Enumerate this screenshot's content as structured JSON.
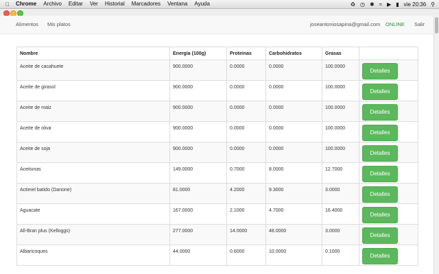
{
  "menubar": {
    "items": [
      "Chrome",
      "Archivo",
      "Editar",
      "Ver",
      "Historial",
      "Marcadores",
      "Ventana",
      "Ayuda"
    ],
    "clock": "vie 20:36"
  },
  "nav": {
    "left": [
      "Alimentos",
      "Mis platos"
    ],
    "email": "joseantoniosapina@gmail.com",
    "status": "ONLINE",
    "logout": "Salir"
  },
  "table": {
    "headers": [
      "Nombre",
      "Energia (100g)",
      "Proteinas",
      "Carbohidratos",
      "Grasas",
      ""
    ],
    "button_label": "Detalles",
    "rows": [
      [
        "Aceite de cacahuete",
        "900.0000",
        "0.0000",
        "0.0000",
        "100.0000"
      ],
      [
        "Aceite de girasol",
        "900.0000",
        "0.0000",
        "0.0000",
        "100.0000"
      ],
      [
        "Aceite de maiz",
        "900.0000",
        "0.0000",
        "0.0000",
        "100.0000"
      ],
      [
        "Aceite de oliva",
        "900.0000",
        "0.0000",
        "0.0000",
        "100.0000"
      ],
      [
        "Aceite de soja",
        "900.0000",
        "0.0000",
        "0.0000",
        "100.0000"
      ],
      [
        "Aceitunas",
        "149.0000",
        "0.7000",
        "8.0000",
        "12.7000"
      ],
      [
        "Actimel batido (Danone)",
        "81.0000",
        "4.2000",
        "9.3000",
        "3.0000"
      ],
      [
        "Aguacate",
        "167.0000",
        "2.1000",
        "4.7000",
        "16.4000"
      ],
      [
        "All-Bran plus (Kelloggs)",
        "277.0000",
        "14.0000",
        "48.0000",
        "3.0000"
      ],
      [
        "Albaricoques",
        "44.0000",
        "0.6000",
        "10.0000",
        "0.1000"
      ]
    ]
  }
}
